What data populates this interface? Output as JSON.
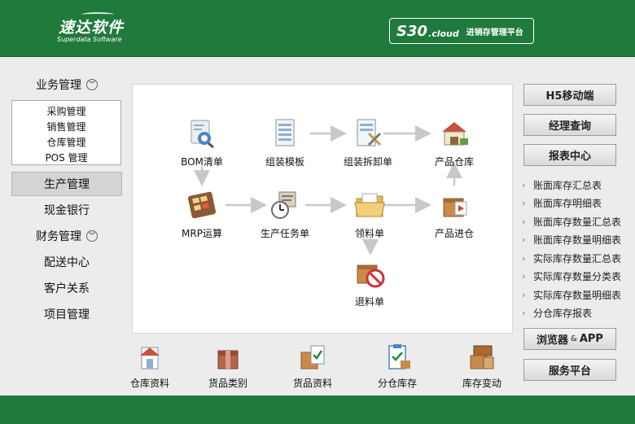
{
  "header": {
    "logo_cn": "速达软件",
    "logo_en": "Superdata Software",
    "product_code": "S30",
    "product_suffix": ".cloud",
    "product_desc": "进销存管理平台"
  },
  "colors": {
    "brand_green": "#1f7a3c",
    "panel_bg": "#ececec",
    "arrow_gray": "#c8c8c8"
  },
  "nav": {
    "business": "业务管理",
    "sub_items": [
      "采购管理",
      "销售管理",
      "仓库管理",
      "POS 管理"
    ],
    "production": "生产管理",
    "cash": "现金银行",
    "finance": "财务管理",
    "delivery": "配送中心",
    "customer": "客户关系",
    "project": "项目管理"
  },
  "flow": {
    "bom": "BOM清单",
    "template": "组装模板",
    "assembly": "组装拆卸单",
    "warehouse": "产品仓库",
    "mrp": "MRP运算",
    "task": "生产任务单",
    "picking": "领料单",
    "inbound": "产品进仓",
    "return": "退料单"
  },
  "strip": [
    "仓库资料",
    "货品类别",
    "货品资料",
    "分仓库存",
    "库存变动"
  ],
  "right": {
    "h5": "H5移动端",
    "manager": "经理查询",
    "reports": "报表中心",
    "report_items": [
      "账面库存汇总表",
      "账面库存明细表",
      "账面库存数量汇总表",
      "账面库存数量明细表",
      "实际库存数量汇总表",
      "实际库存数量分类表",
      "实际库存数量明细表",
      "分仓库存报表"
    ],
    "browser": "浏览器",
    "browser_amp": "&",
    "browser_app": "APP",
    "service": "服务平台"
  }
}
